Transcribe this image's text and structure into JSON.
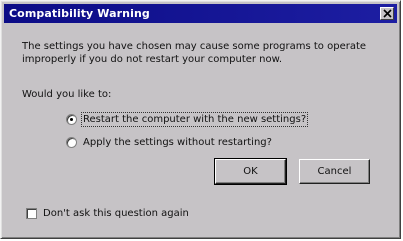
{
  "dialog": {
    "title": "Compatibility Warning",
    "message": "The settings you have chosen may cause some programs to operate improperly if you do not restart your computer now.",
    "prompt": "Would you like to:",
    "options": [
      {
        "label": "Restart the computer with the new settings?",
        "selected": true
      },
      {
        "label": "Apply the settings without restarting?",
        "selected": false
      }
    ],
    "ok_label": "OK",
    "cancel_label": "Cancel",
    "dont_ask_label": "Don't ask this question again",
    "dont_ask_checked": false
  },
  "icons": {
    "close": "close-icon"
  },
  "colors": {
    "titlebar": "#0c0c86",
    "face": "#c6c3c6"
  }
}
